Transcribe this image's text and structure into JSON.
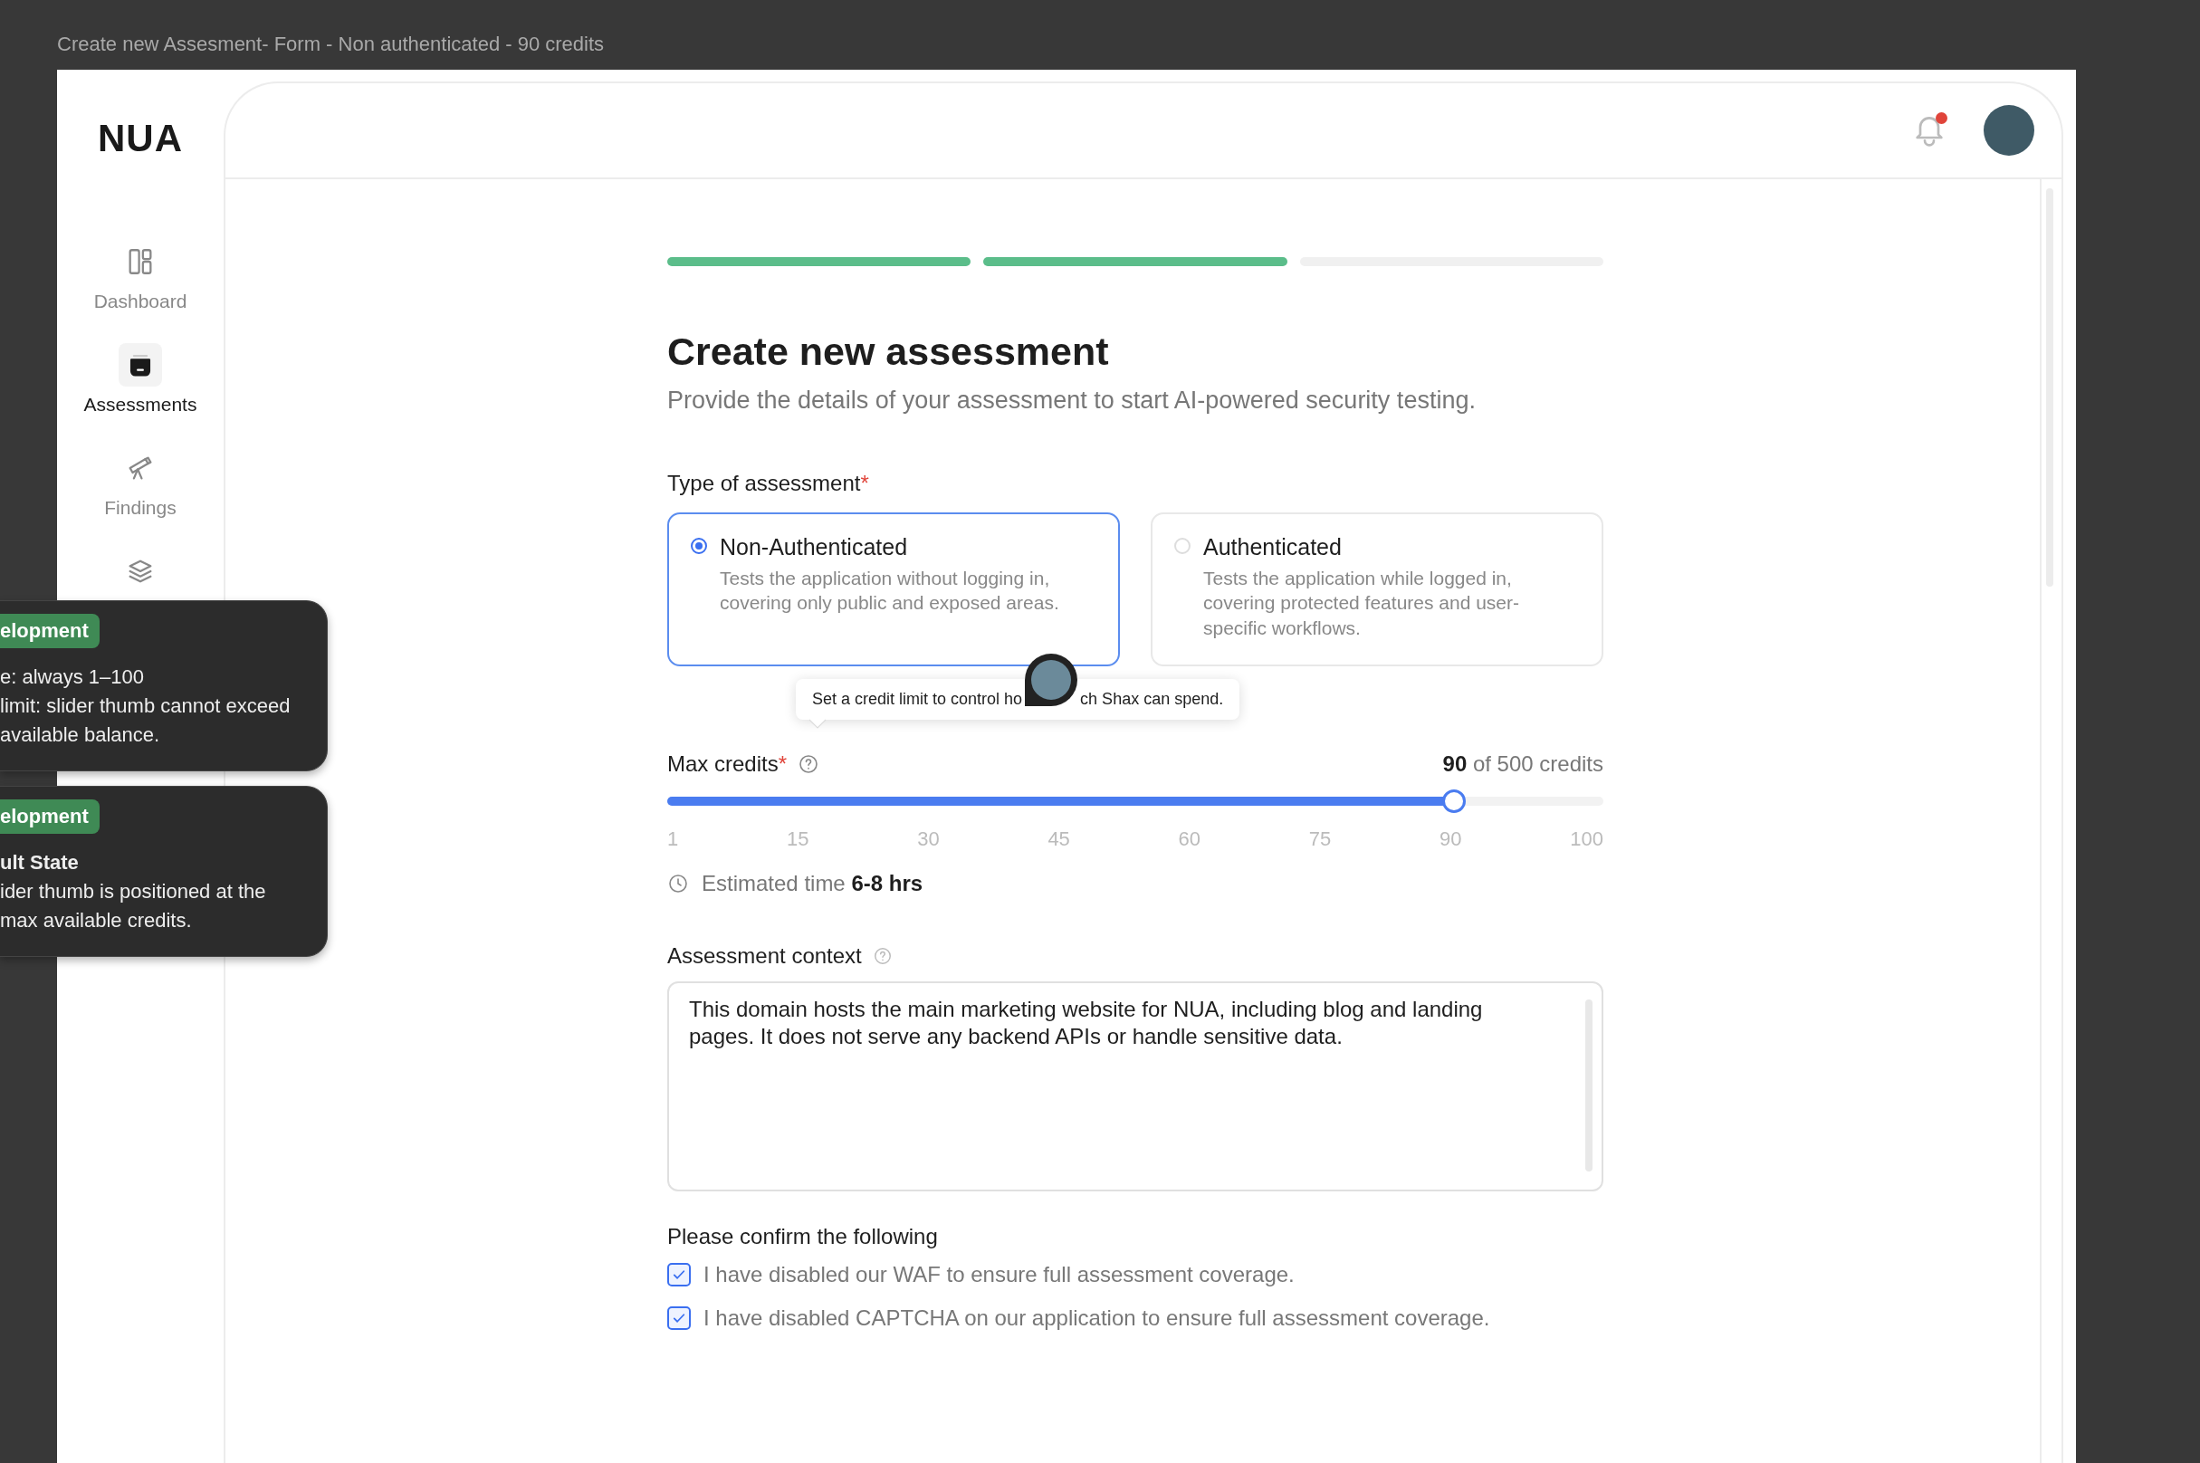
{
  "frame_title": "Create new Assesment- Form - Non authenticated - 90 credits",
  "sidebar": {
    "logo": "NUA",
    "items": [
      {
        "kind": "dashboard",
        "label": "Dashboard",
        "selected": false
      },
      {
        "kind": "assessments",
        "label": "Assessments",
        "selected": true
      },
      {
        "kind": "findings",
        "label": "Findings",
        "selected": false
      },
      {
        "kind": "layers",
        "selected": false
      }
    ]
  },
  "topbar": {
    "notifications": {
      "unread": true
    }
  },
  "progress": [
    {
      "completed": true
    },
    {
      "completed": true
    },
    {
      "completed": false
    }
  ],
  "title": "Create new assessment",
  "subtitle": "Provide the details of your assessment to start AI-powered security testing.",
  "assessment_type": {
    "label": "Type of assessment",
    "required_mark": "*",
    "options": [
      {
        "title": "Non-Authenticated",
        "description": "Tests the application without logging in, covering only public and exposed areas.",
        "selected": true
      },
      {
        "title": "Authenticated",
        "description": "Tests the application while logged in, covering protected features and user-specific workflows.",
        "selected": false
      }
    ]
  },
  "tooltip": {
    "text_before": "Set a credit limit to control ho",
    "text_after": "ch Shax can spend."
  },
  "max_credits": {
    "label": "Max credits",
    "required_mark": "*",
    "value": "**90** of 500 credits",
    "level": 0.84,
    "ticks": [
      "1",
      "15",
      "30",
      "45",
      "60",
      "75",
      "90",
      "100"
    ]
  },
  "estimated_time": "Estimated time **6-8 hrs**",
  "context": {
    "label": "Assessment context",
    "value": "This domain hosts the main marketing website for NUA, including blog and landing pages. It does not serve any backend APIs or handle sensitive data."
  },
  "confirm": {
    "heading": "Please confirm the following",
    "items": [
      {
        "label": "I have disabled our WAF to ensure full assessment coverage.",
        "checked": true
      },
      {
        "label": "I have disabled CAPTCHA on our application to ensure full assessment coverage.",
        "checked": true
      }
    ]
  },
  "annotations": [
    {
      "badge": "elopment",
      "lines": [
        {
          "text": "e: always 1–100",
          "bold": false
        },
        {
          "text": "limit: slider thumb cannot exceed",
          "bold": false
        },
        {
          "text": "available balance.",
          "bold": false
        }
      ]
    },
    {
      "badge": "elopment",
      "lines": [
        {
          "text": "ult State",
          "bold": true
        },
        {
          "text": "ider thumb is positioned at the",
          "bold": false
        },
        {
          "text": "max available credits.",
          "bold": false
        }
      ]
    }
  ]
}
